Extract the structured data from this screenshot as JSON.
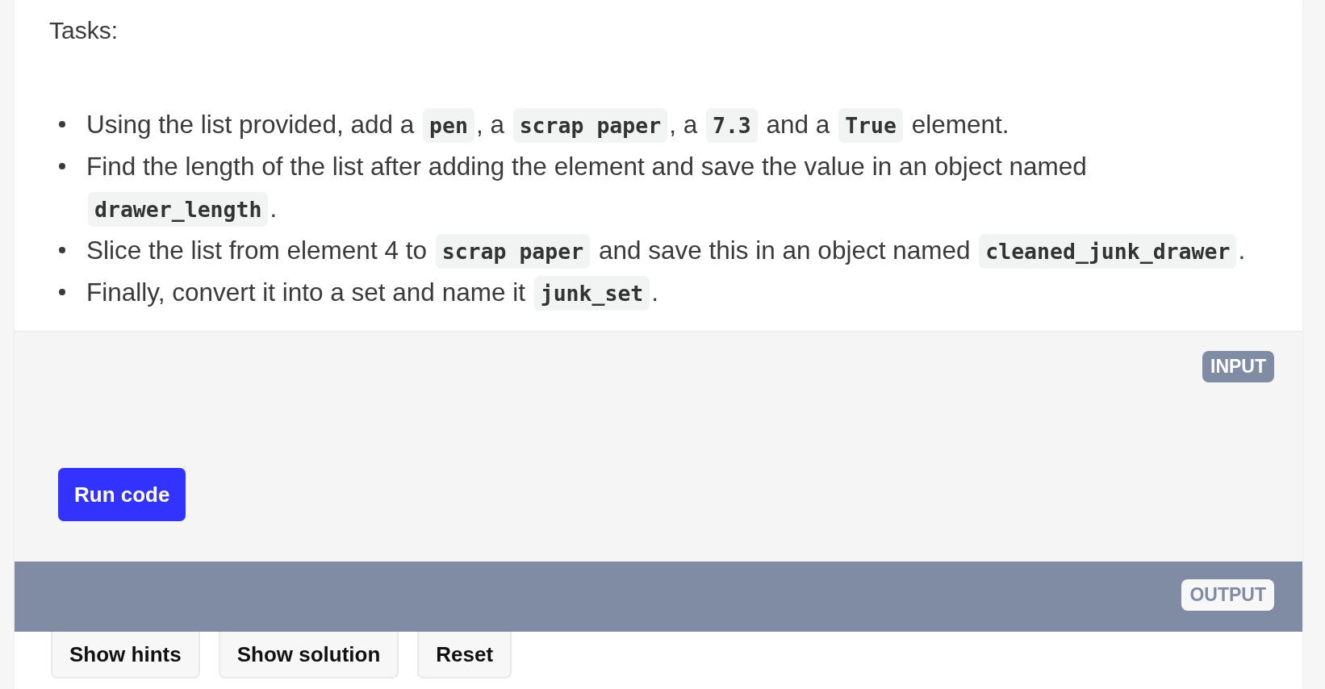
{
  "heading": "Tasks:",
  "tasks": [
    {
      "parts": [
        {
          "kind": "text",
          "text": "Using the list provided, add a "
        },
        {
          "kind": "code",
          "text": "pen"
        },
        {
          "kind": "text",
          "text": ", a "
        },
        {
          "kind": "code",
          "text": "scrap paper"
        },
        {
          "kind": "text",
          "text": ", a "
        },
        {
          "kind": "code",
          "text": "7.3"
        },
        {
          "kind": "text",
          "text": " and a "
        },
        {
          "kind": "code",
          "text": "True"
        },
        {
          "kind": "text",
          "text": " element."
        }
      ]
    },
    {
      "parts": [
        {
          "kind": "text",
          "text": "Find the length of the list after adding the element and save the value in an object named "
        },
        {
          "kind": "code",
          "text": "drawer_length"
        },
        {
          "kind": "text",
          "text": "."
        }
      ]
    },
    {
      "parts": [
        {
          "kind": "text",
          "text": "Slice the list from element 4 to "
        },
        {
          "kind": "code",
          "text": "scrap paper"
        },
        {
          "kind": "text",
          "text": " and save this in an object named "
        },
        {
          "kind": "code",
          "text": "cleaned_junk_drawer"
        },
        {
          "kind": "text",
          "text": "."
        }
      ]
    },
    {
      "parts": [
        {
          "kind": "text",
          "text": "Finally, convert it into a set and name it "
        },
        {
          "kind": "code",
          "text": "junk_set"
        },
        {
          "kind": "text",
          "text": "."
        }
      ]
    }
  ],
  "editor": {
    "label": "INPUT",
    "run_button": "Run code"
  },
  "output": {
    "label": "OUTPUT"
  },
  "actions": [
    "Show hints",
    "Show solution",
    "Reset"
  ]
}
